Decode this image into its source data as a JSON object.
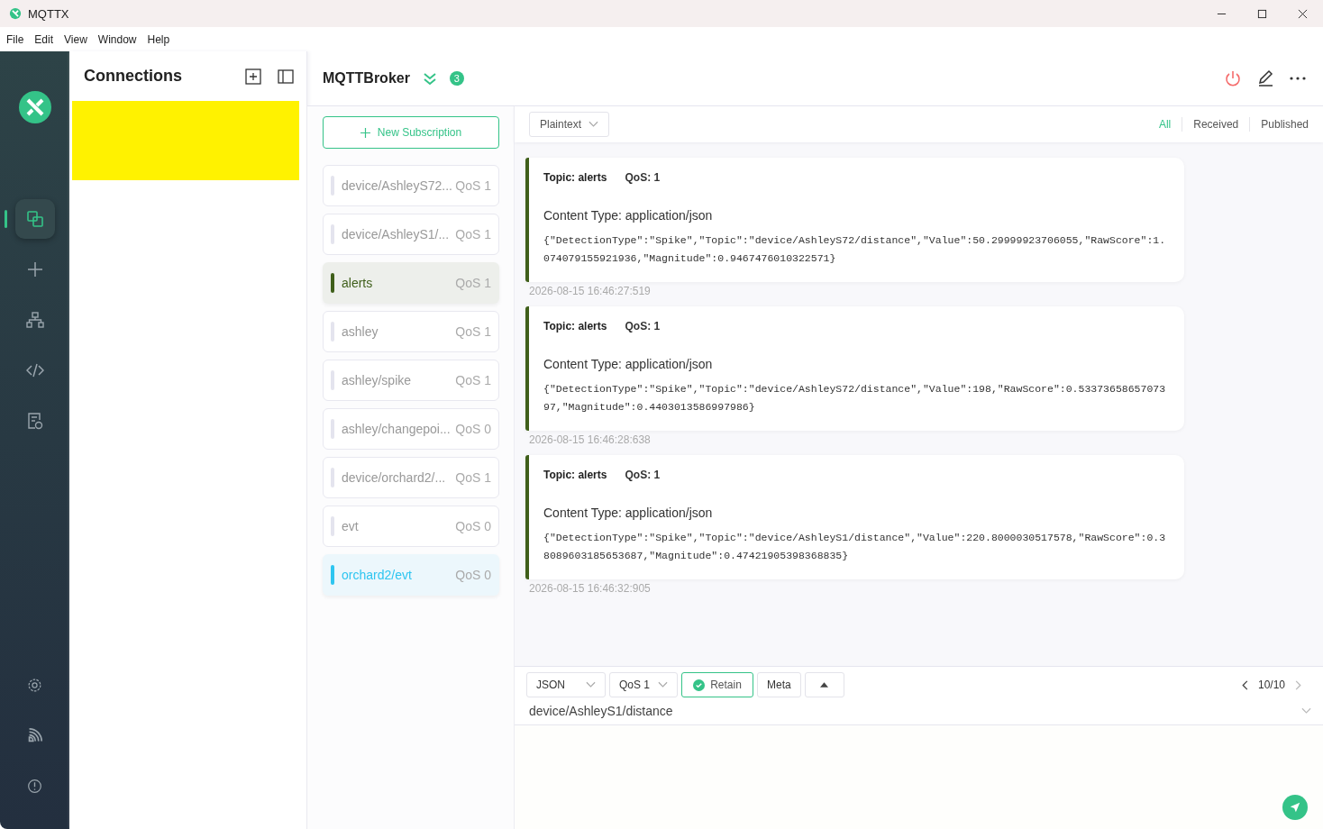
{
  "window": {
    "title": "MQTTX"
  },
  "menu": [
    "File",
    "Edit",
    "View",
    "Window",
    "Help"
  ],
  "nav": [
    {
      "kind": "connections",
      "selected": true
    },
    {
      "kind": "new",
      "selected": false
    },
    {
      "kind": "tree",
      "selected": false
    },
    {
      "kind": "script",
      "selected": false
    },
    {
      "kind": "log",
      "selected": false
    }
  ],
  "nav_bottom": [
    {
      "kind": "settings"
    },
    {
      "kind": "feed"
    },
    {
      "kind": "about"
    }
  ],
  "connections": {
    "title": "Connections"
  },
  "broker": {
    "name": "MQTTBroker",
    "badge": "3"
  },
  "subscriptions": {
    "new_button": "New Subscription",
    "items": [
      {
        "topic": "device/AshleyS72...",
        "qos": "QoS 1",
        "color": "#e4e4ee",
        "highlighted": false
      },
      {
        "topic": "device/AshleyS1/...",
        "qos": "QoS 1",
        "color": "#e4e4ee",
        "highlighted": false
      },
      {
        "topic": "alerts",
        "qos": "QoS 1",
        "color": "#3f5f1a",
        "highlighted": true
      },
      {
        "topic": "ashley",
        "qos": "QoS 1",
        "color": "#e4e4ee",
        "highlighted": false
      },
      {
        "topic": "ashley/spike",
        "qos": "QoS 1",
        "color": "#e4e4ee",
        "highlighted": false
      },
      {
        "topic": "ashley/changepoi...",
        "qos": "QoS 0",
        "color": "#e4e4ee",
        "highlighted": false
      },
      {
        "topic": "device/orchard2/...",
        "qos": "QoS 1",
        "color": "#e4e4ee",
        "highlighted": false
      },
      {
        "topic": "evt",
        "qos": "QoS 0",
        "color": "#e4e4ee",
        "highlighted": false
      },
      {
        "topic": "orchard2/evt",
        "qos": "QoS 0",
        "color": "#2ec5f0",
        "highlighted": true
      }
    ]
  },
  "format": "Plaintext",
  "filters": [
    {
      "label": "All",
      "selected": true
    },
    {
      "label": "Received",
      "selected": false
    },
    {
      "label": "Published",
      "selected": false
    }
  ],
  "messages": [
    {
      "topic": "Topic: alerts",
      "qos": "QoS: 1",
      "content_type": "Content Type: application/json",
      "payload": "{\"DetectionType\":\"Spike\",\"Topic\":\"device/AshleyS72/distance\",\"Value\":50.29999923706055,\"RawScore\":1.074079155921936,\"Magnitude\":0.9467476010322571}",
      "time": "2026-08-15 16:46:27:519",
      "color": "#3f5f1a"
    },
    {
      "topic": "Topic: alerts",
      "qos": "QoS: 1",
      "content_type": "Content Type: application/json",
      "payload": "{\"DetectionType\":\"Spike\",\"Topic\":\"device/AshleyS72/distance\",\"Value\":198,\"RawScore\":0.5337365865707397,\"Magnitude\":0.4403013586997986}",
      "time": "2026-08-15 16:46:28:638",
      "color": "#3f5f1a"
    },
    {
      "topic": "Topic: alerts",
      "qos": "QoS: 1",
      "content_type": "Content Type: application/json",
      "payload": "{\"DetectionType\":\"Spike\",\"Topic\":\"device/AshleyS1/distance\",\"Value\":220.8000030517578,\"RawScore\":0.38089603185653687,\"Magnitude\":0.47421905398368835}",
      "time": "2026-08-15 16:46:32:905",
      "color": "#3f5f1a"
    }
  ],
  "composer": {
    "format": "JSON",
    "qos": "QoS 1",
    "retain": {
      "label": "Retain",
      "checked": true
    },
    "meta": "Meta",
    "page": "10/10",
    "topic": "device/AshleyS1/distance"
  }
}
